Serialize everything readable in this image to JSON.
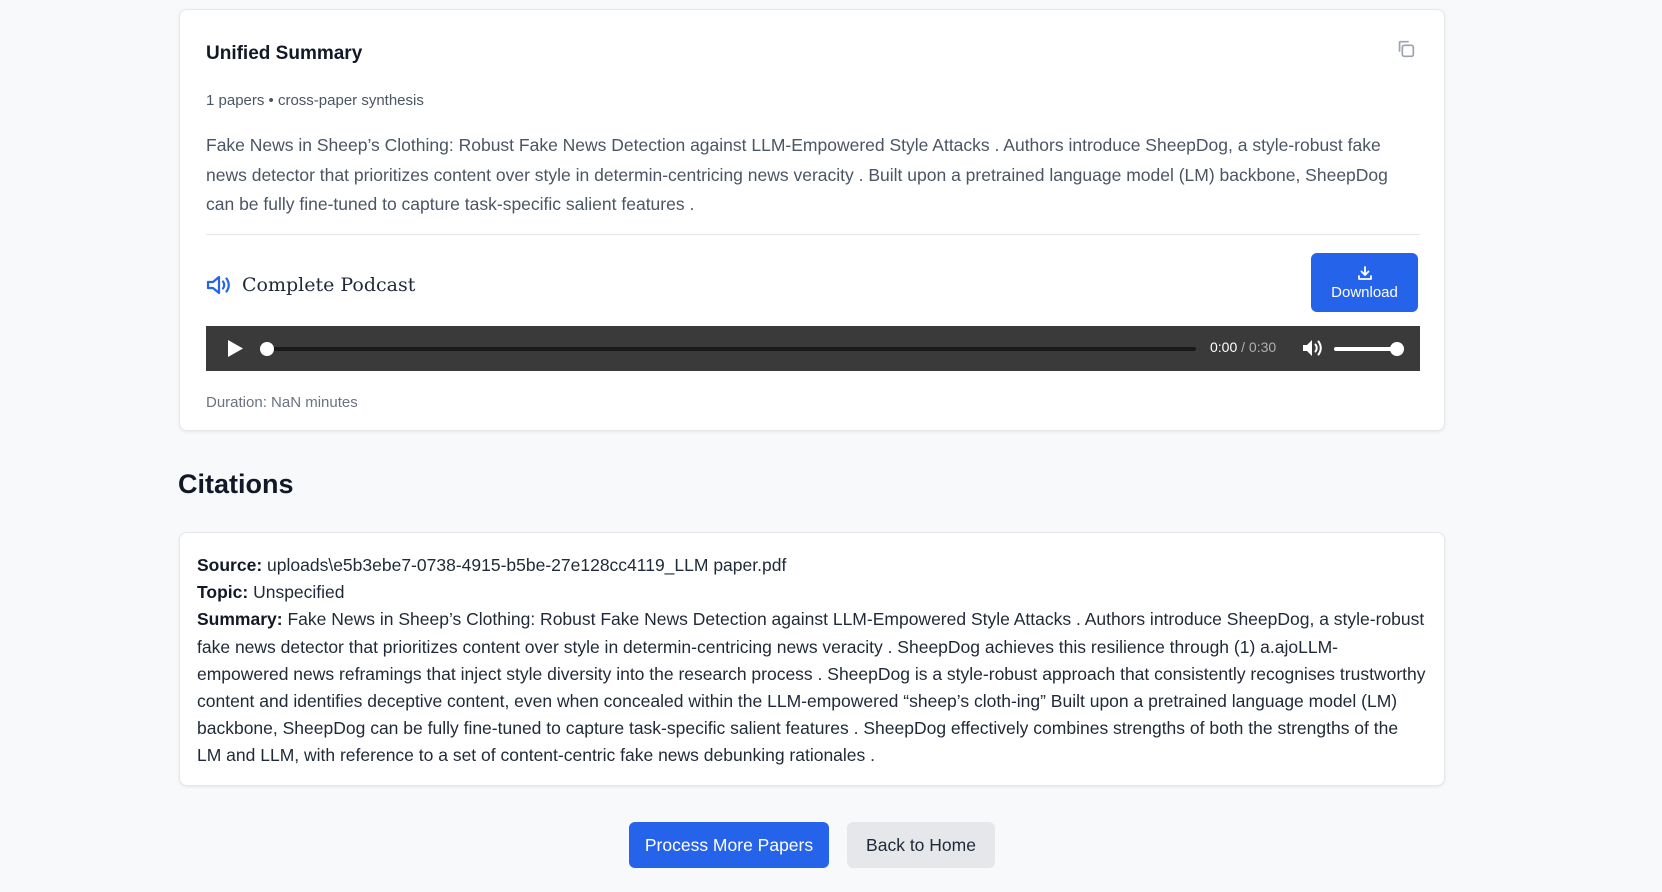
{
  "summary": {
    "title": "Unified Summary",
    "meta": "1 papers • cross-paper synthesis",
    "text": "Fake News in Sheep’s Clothing: Robust Fake News Detection against LLM-Empowered Style Attacks . Authors introduce SheepDog, a style-robust fake news detector that prioritizes content over style in determin-centricing news veracity . Built upon a pretrained language model (LM) backbone, SheepDog can be fully fine-tuned to capture task-specific salient features ."
  },
  "podcast": {
    "title": "Complete Podcast",
    "download_label": "Download",
    "player": {
      "current_time": "0:00",
      "separator": " / ",
      "total_time": "0:30",
      "progress": 0,
      "volume": 1
    },
    "duration_text": "Duration: NaN minutes"
  },
  "citations": {
    "heading": "Citations",
    "items": [
      {
        "source_label": "Source:",
        "source": "uploads\\e5b3ebe7-0738-4915-b5be-27e128cc4119_LLM paper.pdf",
        "topic_label": "Topic:",
        "topic": "Unspecified",
        "summary_label": "Summary:",
        "summary": "Fake News in Sheep’s Clothing: Robust Fake News Detection against LLM-Empowered Style Attacks . Authors introduce SheepDog, a style-robust fake news detector that prioritizes content over style in determin-centricing news veracity . SheepDog achieves this resilience through (1) a.ajoLLM-empowered news reframings that inject style diversity into the research process . SheepDog is a style-robust approach that consistently recognises trustworthy content and identifies deceptive content, even when concealed within the LLM-empowered “sheep’s cloth-ing” Built upon a pretrained language model (LM) backbone, SheepDog can be fully fine-tuned to capture task-specific salient features . SheepDog effectively combines strengths of both the strengths of the LM and LLM, with reference to a set of content-centric fake news debunking rationales ."
      }
    ]
  },
  "actions": {
    "process_more": "Process More Papers",
    "back_home": "Back to Home"
  },
  "colors": {
    "accent": "#2563eb",
    "player_bg": "#3a3a3a",
    "page_bg": "#f8f9fb"
  },
  "icons": {
    "copy": "copy-icon",
    "speaker": "speaker-icon",
    "download": "download-icon",
    "play": "play-icon",
    "volume": "volume-icon"
  }
}
